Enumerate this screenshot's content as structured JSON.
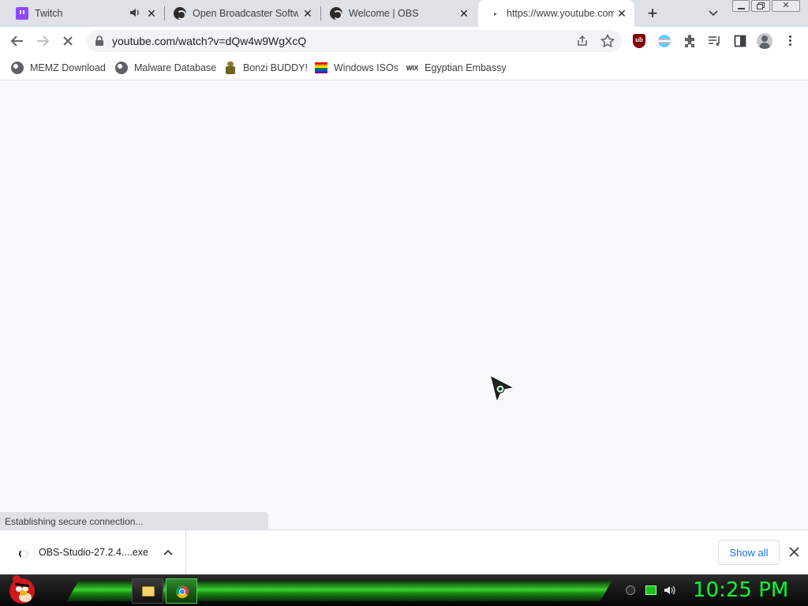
{
  "browser": {
    "tabs": [
      {
        "title": "Twitch",
        "icon": "twitch-icon",
        "audio": true
      },
      {
        "title": "Open Broadcaster Software",
        "icon": "obs-icon"
      },
      {
        "title": "Welcome | OBS",
        "icon": "obs-icon"
      },
      {
        "title": "https://www.youtube.com",
        "icon": "loading-icon",
        "active": true
      }
    ],
    "new_tab_symbol": "+",
    "address": "youtube.com/watch?v=dQw4w9WgXcQ",
    "bookmarks": [
      {
        "label": "MEMZ Download",
        "icon": "globe-icon"
      },
      {
        "label": "Malware Database",
        "icon": "globe-icon"
      },
      {
        "label": "Bonzi BUDDY!",
        "icon": "bonzi-icon"
      },
      {
        "label": "Windows ISOs",
        "icon": "rainbow-flag-icon"
      },
      {
        "label": "Egyptian Embassy",
        "icon": "wix-icon"
      }
    ],
    "wix_text": "WIX",
    "ublock_text": "ub"
  },
  "status_text": "Establishing secure connection...",
  "download_bar": {
    "filename": "OBS-Studio-27.2.4....exe",
    "show_all_label": "Show all"
  },
  "taskbar": {
    "clock": "10:25 PM"
  },
  "colors": {
    "accent": "#1a73e8",
    "clock": "#00ff33",
    "taskbar_green": "#39d22d",
    "twitch": "#9146ff"
  }
}
